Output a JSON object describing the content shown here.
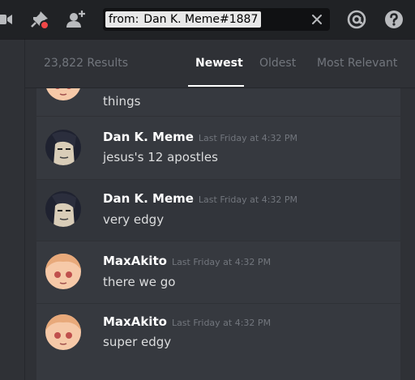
{
  "search": {
    "filter_operator": "from:",
    "filter_value": "Dan K. Meme#1887"
  },
  "results": {
    "count_label": "23,822 Results",
    "tabs": [
      {
        "label": "Newest",
        "active": true
      },
      {
        "label": "Oldest",
        "active": false
      },
      {
        "label": "Most Relevant",
        "active": false
      }
    ],
    "messages": [
      {
        "author": "",
        "timestamp": "",
        "content": "things",
        "avatar": "maxakito-avatar"
      },
      {
        "author": "Dan K. Meme",
        "timestamp": "Last Friday at 4:32 PM",
        "content": "jesus's 12 apostles",
        "avatar": "dan-k-meme-avatar"
      },
      {
        "author": "Dan K. Meme",
        "timestamp": "Last Friday at 4:32 PM",
        "content": "very edgy",
        "avatar": "dan-k-meme-avatar",
        "highlighted": true
      },
      {
        "author": "MaxAkito",
        "timestamp": "Last Friday at 4:32 PM",
        "content": "there we go",
        "avatar": "maxakito-avatar"
      },
      {
        "author": "MaxAkito",
        "timestamp": "Last Friday at 4:32 PM",
        "content": "super edgy",
        "avatar": "maxakito-avatar"
      }
    ]
  },
  "toolbar_icons": [
    "video-call-icon",
    "pin-icon",
    "add-member-icon",
    "mention-icon",
    "help-icon"
  ],
  "colors": {
    "background": "#202225",
    "panel": "#2f3136",
    "message_bg": "#36393f",
    "muted_text": "#72767d",
    "pin_dot": "#f04747"
  }
}
